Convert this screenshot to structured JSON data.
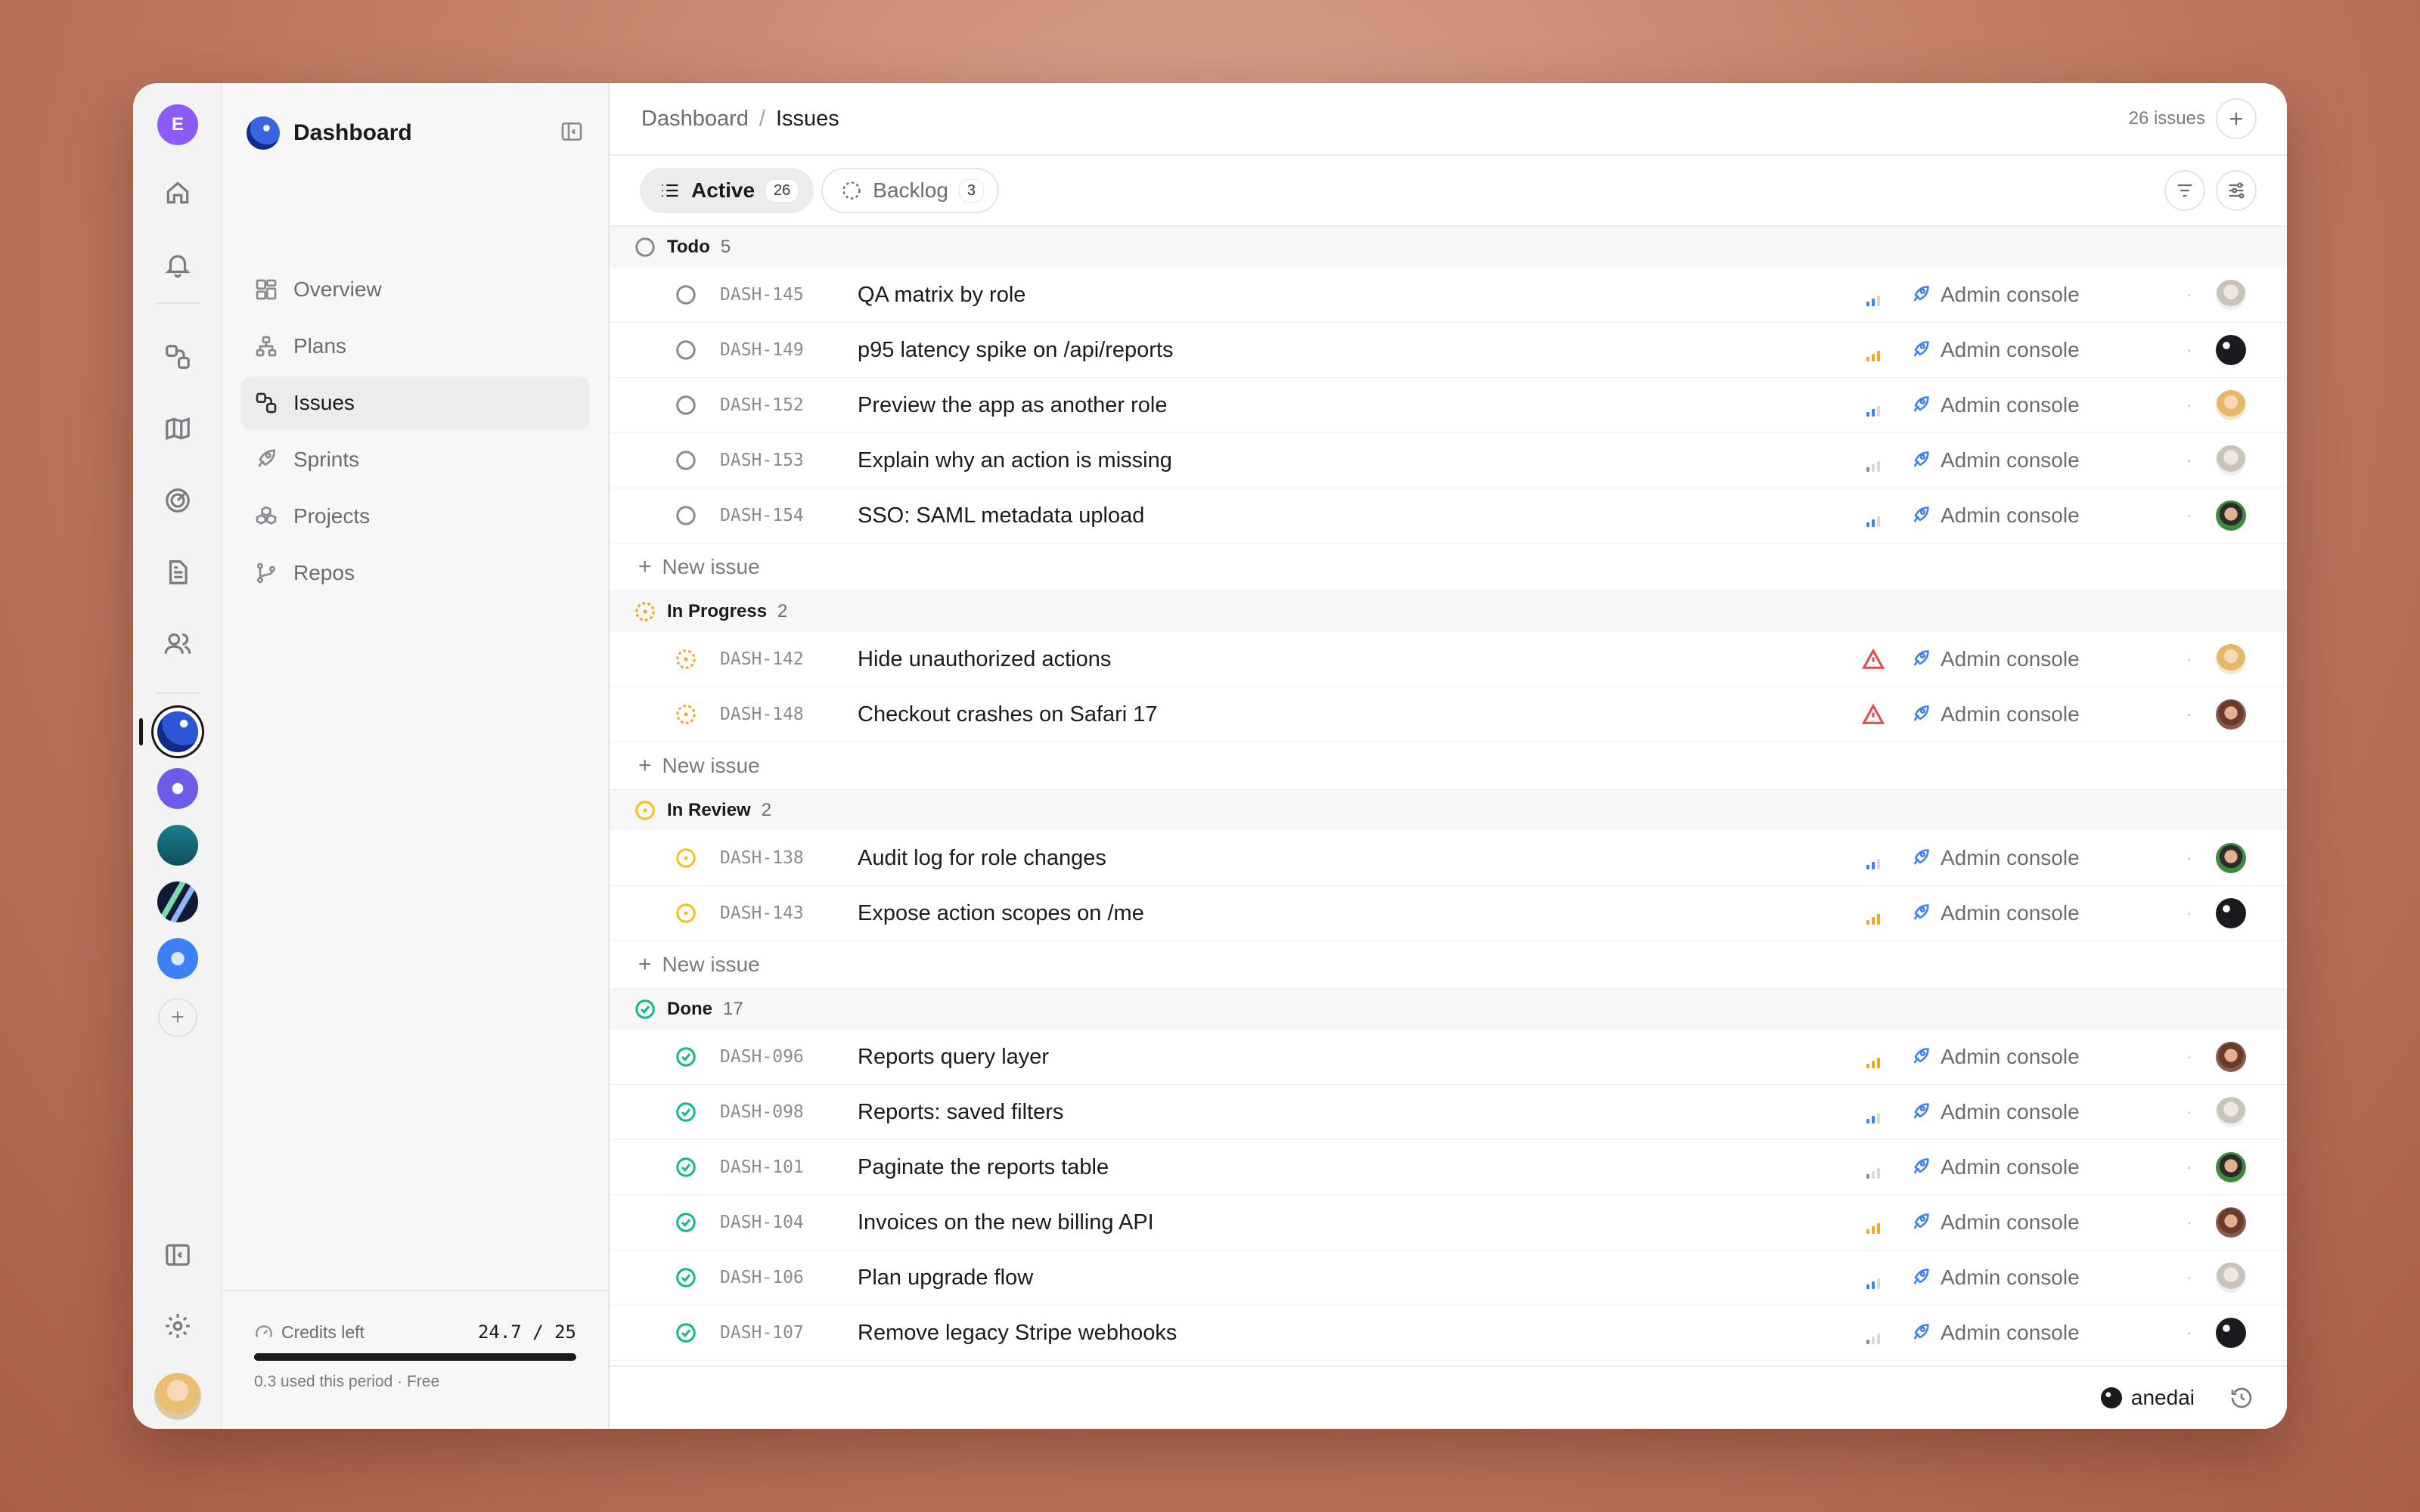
{
  "rail": {
    "user_initial": "E",
    "icons": [
      "home-icon",
      "bell-icon",
      "issues-icon",
      "map-icon",
      "radar-icon",
      "document-icon",
      "people-icon"
    ],
    "workspaces": [
      {
        "name": "dashboard",
        "color": "#1e3fae"
      },
      {
        "name": "saturn",
        "color": "#6d5ce8"
      },
      {
        "name": "forest",
        "color": "#136a7a"
      },
      {
        "name": "stripes",
        "color": "#121a33"
      },
      {
        "name": "cube",
        "color": "#3b82f6"
      }
    ],
    "add_label": "+"
  },
  "sidebar": {
    "title": "Dashboard",
    "items": [
      {
        "label": "Overview",
        "icon": "layout-icon",
        "active": false
      },
      {
        "label": "Plans",
        "icon": "hierarchy-icon",
        "active": false
      },
      {
        "label": "Issues",
        "icon": "issues-icon",
        "active": true
      },
      {
        "label": "Sprints",
        "icon": "rocket-icon",
        "active": false
      },
      {
        "label": "Projects",
        "icon": "cubes-icon",
        "active": false
      },
      {
        "label": "Repos",
        "icon": "branch-icon",
        "active": false
      }
    ],
    "credits": {
      "label": "Credits left",
      "value": "24.7 / 25",
      "fraction": 0.988,
      "sub": "0.3 used this period · Free"
    }
  },
  "header": {
    "breadcrumb_root": "Dashboard",
    "breadcrumb_sep": "/",
    "breadcrumb_current": "Issues",
    "count": "26 issues"
  },
  "tabs": [
    {
      "label": "Active",
      "count": "26",
      "active": true
    },
    {
      "label": "Backlog",
      "count": "3",
      "active": false
    }
  ],
  "new_issue_label": "New issue",
  "groups": [
    {
      "name": "Todo",
      "count": "5",
      "status": "todo",
      "issues": [
        {
          "id": "DASH-145",
          "title": "QA matrix by role",
          "priority": "low",
          "project": "Admin console",
          "assignee": "gray"
        },
        {
          "id": "DASH-149",
          "title": "p95 latency spike on /api/reports",
          "priority": "high",
          "project": "Admin console",
          "assignee": "dark"
        },
        {
          "id": "DASH-152",
          "title": "Preview the app as another role",
          "priority": "low",
          "project": "Admin console",
          "assignee": "blonde"
        },
        {
          "id": "DASH-153",
          "title": "Explain why an action is missing",
          "priority": "none",
          "project": "Admin console",
          "assignee": "gray"
        },
        {
          "id": "DASH-154",
          "title": "SSO: SAML metadata upload",
          "priority": "low",
          "project": "Admin console",
          "assignee": "green"
        }
      ],
      "show_new": true
    },
    {
      "name": "In Progress",
      "count": "2",
      "status": "progress",
      "issues": [
        {
          "id": "DASH-142",
          "title": "Hide unauthorized actions",
          "priority": "urgent",
          "project": "Admin console",
          "assignee": "blonde"
        },
        {
          "id": "DASH-148",
          "title": "Checkout crashes on Safari 17",
          "priority": "urgent",
          "project": "Admin console",
          "assignee": "brown"
        }
      ],
      "show_new": true
    },
    {
      "name": "In Review",
      "count": "2",
      "status": "review",
      "issues": [
        {
          "id": "DASH-138",
          "title": "Audit log for role changes",
          "priority": "low",
          "project": "Admin console",
          "assignee": "green"
        },
        {
          "id": "DASH-143",
          "title": "Expose action scopes on /me",
          "priority": "high",
          "project": "Admin console",
          "assignee": "dark"
        }
      ],
      "show_new": true
    },
    {
      "name": "Done",
      "count": "17",
      "status": "done",
      "issues": [
        {
          "id": "DASH-096",
          "title": "Reports query layer",
          "priority": "high",
          "project": "Admin console",
          "assignee": "brown"
        },
        {
          "id": "DASH-098",
          "title": "Reports: saved filters",
          "priority": "low",
          "project": "Admin console",
          "assignee": "gray"
        },
        {
          "id": "DASH-101",
          "title": "Paginate the reports table",
          "priority": "none",
          "project": "Admin console",
          "assignee": "green"
        },
        {
          "id": "DASH-104",
          "title": "Invoices on the new billing API",
          "priority": "high",
          "project": "Admin console",
          "assignee": "brown"
        },
        {
          "id": "DASH-106",
          "title": "Plan upgrade flow",
          "priority": "low",
          "project": "Admin console",
          "assignee": "gray"
        },
        {
          "id": "DASH-107",
          "title": "Remove legacy Stripe webhooks",
          "priority": "none",
          "project": "Admin console",
          "assignee": "dark"
        }
      ],
      "show_new": false
    }
  ],
  "footer": {
    "user": "anedai"
  },
  "colors": {
    "todo": "#8a8a90",
    "progress": "#f5a524",
    "review": "#f2c21b",
    "done": "#12b886",
    "priority_high": "#f5a524",
    "priority_low": "#3b82f6",
    "urgent": "#e5484d",
    "accent": "#3b82f6"
  }
}
